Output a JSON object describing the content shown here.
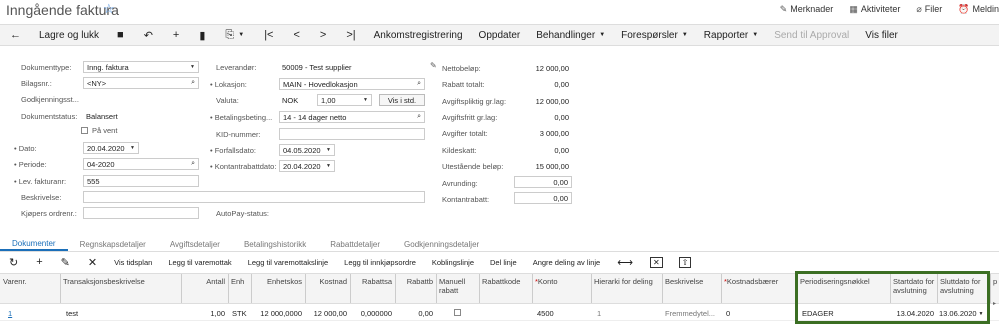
{
  "page_title": "Inngående faktura",
  "top_links": [
    {
      "icon": "notes-icon",
      "label": "Merknader"
    },
    {
      "icon": "activities-icon",
      "label": "Aktiviteter"
    },
    {
      "icon": "files-icon",
      "label": "Filer"
    },
    {
      "icon": "notifications-icon",
      "label": "Meldin"
    }
  ],
  "toolbar": {
    "back_icon": "←",
    "save_close": "Lagre og lukk",
    "save_icon": "💾",
    "undo_icon": "↶",
    "add_icon": "+",
    "delete_icon": "🗑",
    "copy_icon": "⎘",
    "first_icon": "|<",
    "prev_icon": "<",
    "next_icon": ">",
    "last_icon": ">|",
    "arrival_registration": "Ankomstregistrering",
    "update": "Oppdater",
    "actions": "Behandlinger",
    "inquiries": "Forespørsler",
    "reports": "Rapporter",
    "send_approval": "Send til Approval",
    "show_files": "Vis filer"
  },
  "form": {
    "doc_type_label": "Dokumenttype:",
    "doc_type_value": "Inng. faktura",
    "voucher_label": "Bilagsnr.:",
    "voucher_value": "<NY>",
    "approval_label": "Godkjenningsst...",
    "doc_status_label": "Dokumentstatus:",
    "doc_status_value": "Balansert",
    "on_hold_label": "På vent",
    "date_label": "Dato:",
    "date_value": "20.04.2020",
    "period_label": "Periode:",
    "period_value": "04-2020",
    "supplier_invoice_label": "Lev. fakturanr:",
    "supplier_invoice_value": "555",
    "description_label": "Beskrivelse:",
    "buyer_order_label": "Kjøpers ordrenr.:",
    "supplier_label": "Leverandør:",
    "supplier_value": "50009 - Test supplier",
    "location_label": "Lokasjon:",
    "location_value": "MAIN - Hovedlokasjon",
    "currency_label": "Valuta:",
    "currency_value": "NOK",
    "rate_value": "1,00",
    "show_std": "Vis i std.",
    "payment_terms_label": "Betalingsbeting...",
    "payment_terms_value": "14 - 14 dager netto",
    "kid_label": "KID-nummer:",
    "due_date_label": "Forfallsdato:",
    "due_date_value": "04.05.2020",
    "cash_discount_date_label": "Kontantrabattdato:",
    "cash_discount_date_value": "20.04.2020",
    "autopay_label": "AutoPay-status:",
    "net_amount_label": "Nettobeløp:",
    "net_amount_value": "12 000,00",
    "discount_total_label": "Rabatt totalt:",
    "discount_total_value": "0,00",
    "taxable_label": "Avgiftspliktig gr.lag:",
    "taxable_value": "12 000,00",
    "tax_free_label": "Avgiftsfritt gr.lag:",
    "tax_free_value": "0,00",
    "tax_total_label": "Avgifter totalt:",
    "tax_total_value": "3 000,00",
    "withholding_label": "Kildeskatt:",
    "withholding_value": "0,00",
    "outstanding_label": "Utestående beløp:",
    "outstanding_value": "15 000,00",
    "rounding_label": "Avrunding:",
    "rounding_value": "0,00",
    "cash_discount_label": "Kontantrabatt:",
    "cash_discount_value": "0,00"
  },
  "tabs": [
    "Dokumenter",
    "Regnskapsdetaljer",
    "Avgiftsdetaljer",
    "Betalingshistorikk",
    "Rabattdetaljer",
    "Godkjenningsdetaljer"
  ],
  "grid_toolbar": {
    "refresh_icon": "↻",
    "add_icon": "+",
    "edit_icon": "✎",
    "delete_icon": "✕",
    "show_schedule": "Vis tidsplan",
    "add_to_receipt": "Legg til varemottak",
    "add_receipt_line": "Legg til varemottakslinje",
    "add_purchase_order": "Legg til innkjøpsordre",
    "link_line": "Koblingslinje",
    "split_line": "Del linje",
    "undo_split": "Angre deling av linje",
    "fit_icon": "⟷",
    "close_box_icon": "✕",
    "export_icon": "⇧"
  },
  "grid_headers": {
    "item_no": "Varenr.",
    "transaction_desc": "Transaksjonsbeskrivelse",
    "quantity": "Antall",
    "unit": "Enh",
    "unit_cost": "Enhetskos",
    "cost": "Kostnad",
    "discount_pct": "Rabattsa",
    "discount": "Rabattb",
    "manual_discount": "Manuell rabatt",
    "discount_code": "Rabattkode",
    "account": "Konto",
    "hierarchy": "Hierarki for deling",
    "description": "Beskrivelse",
    "cost_bearer": "Kostnadsbærer",
    "deferral_code": "Periodiseringsnøkkel",
    "start_date": "Startdato for avslutning",
    "end_date": "Sluttdato for avslutning",
    "extra": "p"
  },
  "grid_rows": [
    {
      "line": "1",
      "transaction_desc": "test",
      "quantity": "1,00",
      "unit": "STK",
      "unit_cost": "12 000,0000",
      "cost": "12 000,00",
      "discount_pct": "0,000000",
      "discount": "0,00",
      "account": "4500",
      "hierarchy": "1",
      "description": "Fremmedytel...",
      "cost_bearer": "0",
      "deferral_code": "EDAGER",
      "start_date": "13.04.2020",
      "end_date": "13.06.2020"
    }
  ],
  "colors": {
    "highlight": "#3b6e23",
    "accent": "#1b6fb9"
  }
}
